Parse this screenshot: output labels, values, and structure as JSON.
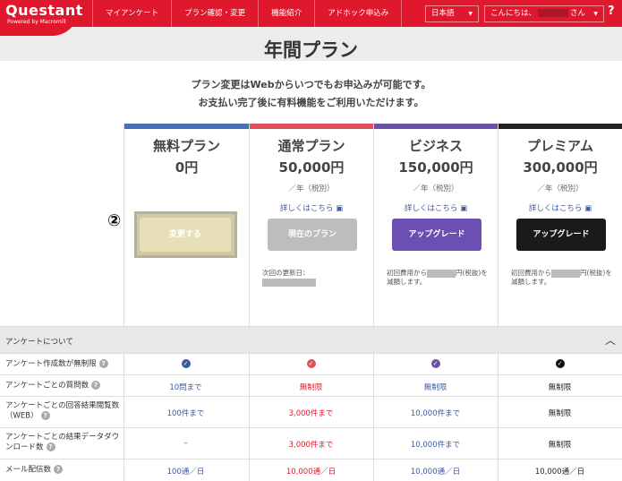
{
  "app": {
    "logo": "Questant",
    "logo_sub": "Powered by Macromill"
  },
  "nav": {
    "items": [
      "マイアンケート",
      "プラン確認・変更",
      "機能紹介",
      "アドホック申込み"
    ]
  },
  "header_controls": {
    "language": "日本語",
    "greeting_prefix": "こんにちは、",
    "greeting_suffix": "さん",
    "help": "?"
  },
  "page": {
    "title": "年間プラン",
    "intro_line1": "プラン変更はWebからいつでもお申込みが可能です。",
    "intro_line2": "お支払い完了後に有料機能をご利用いただけます。",
    "step_marker": "②"
  },
  "plans": [
    {
      "name": "無料プラン",
      "price": "0円",
      "unit": "",
      "detail_link": "",
      "button": "変更する",
      "note": "",
      "bar_color": "#4a6fb5",
      "button_color": "#e6dfb7"
    },
    {
      "name": "通常プラン",
      "price": "50,000円",
      "unit": "／年（税別）",
      "detail_link": "詳しくはこちら",
      "button": "現在のプラン",
      "note": "次回の更新日：",
      "bar_color": "#e0515c",
      "button_color": "#bdbdbd"
    },
    {
      "name": "ビジネス",
      "price": "150,000円",
      "unit": "／年（税別）",
      "detail_link": "詳しくはこちら",
      "button": "アップグレード",
      "note_prefix": "初回費用から",
      "note_suffix": "円(税抜)を減額します。",
      "bar_color": "#6b52a8",
      "button_color": "#6b4fb2"
    },
    {
      "name": "プレミアム",
      "price": "300,000円",
      "unit": "／年（税別）",
      "detail_link": "詳しくはこちら",
      "button": "アップグレード",
      "note_prefix": "初回費用から",
      "note_suffix": "円(税抜)を減額します。",
      "bar_color": "#222222",
      "button_color": "#1a1a1a"
    }
  ],
  "features": {
    "section_title": "アンケートについて",
    "rows": [
      {
        "label": "アンケート作成数が無制限",
        "values": [
          "check",
          "check",
          "check",
          "check"
        ]
      },
      {
        "label": "アンケートごとの質問数",
        "values": [
          "10問まで",
          "無制限",
          "無制限",
          "無制限"
        ]
      },
      {
        "label": "アンケートごとの回答結果閲覧数（WEB）",
        "values": [
          "100件まで",
          "3,000件まで",
          "10,000件まで",
          "無制限"
        ]
      },
      {
        "label": "アンケートごとの結果データダウンロード数",
        "values": [
          "–",
          "3,000件まで",
          "10,000件まで",
          "無制限"
        ]
      },
      {
        "label": "メール配信数",
        "values": [
          "100通／日",
          "10,000通／日",
          "10,000通／日",
          "10,000通／日"
        ]
      }
    ],
    "column_colors": [
      "#3a5aa0",
      "#e0182d",
      "#3a5aa0",
      "#222222"
    ],
    "check_colors": [
      "#3a5aa0",
      "#e0515c",
      "#6b52a8",
      "#111111"
    ]
  }
}
